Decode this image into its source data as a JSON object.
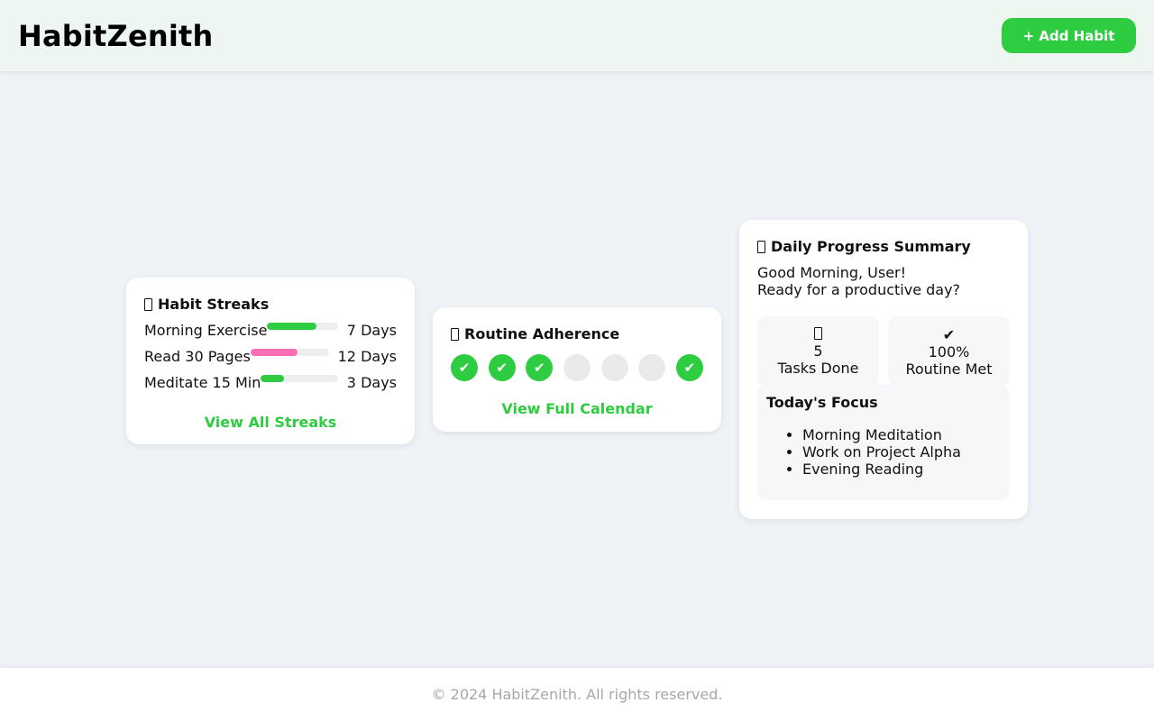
{
  "header": {
    "brand": "HabitZenith",
    "add_button": "+ Add Habit"
  },
  "streaks": {
    "title": "Habit Streaks",
    "icon": "fire-icon",
    "items": [
      {
        "name": "Morning Exercise",
        "days": "7 Days",
        "progress": 0.7,
        "color": "#2ecc40"
      },
      {
        "name": "Read 30 Pages",
        "days": "12 Days",
        "progress": 0.6,
        "color": "#ff6eb4"
      },
      {
        "name": "Meditate 15 Min",
        "days": "3 Days",
        "progress": 0.3,
        "color": "#2ecc40"
      }
    ],
    "link": "View All Streaks"
  },
  "adherence": {
    "title": "Routine Adherence",
    "icon": "calendar-icon",
    "days": [
      true,
      true,
      true,
      false,
      false,
      false,
      true
    ],
    "check": "✔",
    "link": "View Full Calendar"
  },
  "summary": {
    "title": "Daily Progress Summary",
    "icon": "chart-icon",
    "greeting_line1": "Good Morning, User!",
    "greeting_line2": "Ready for a productive day?",
    "stats": [
      {
        "icon": "trophy-icon",
        "glyph": "",
        "value": "5",
        "label": "Tasks Done"
      },
      {
        "icon": "check-icon",
        "glyph": "✔",
        "value": "100%",
        "label": "Routine Met"
      }
    ],
    "focus_title": "Today's Focus",
    "focus_items": [
      "Morning Meditation",
      "Work on Project Alpha",
      "Evening Reading"
    ]
  },
  "footer": {
    "text": "© 2024 HabitZenith. All rights reserved."
  },
  "colors": {
    "accent": "#2ecc40",
    "pink": "#ff6eb4",
    "background": "#eff2f7"
  }
}
